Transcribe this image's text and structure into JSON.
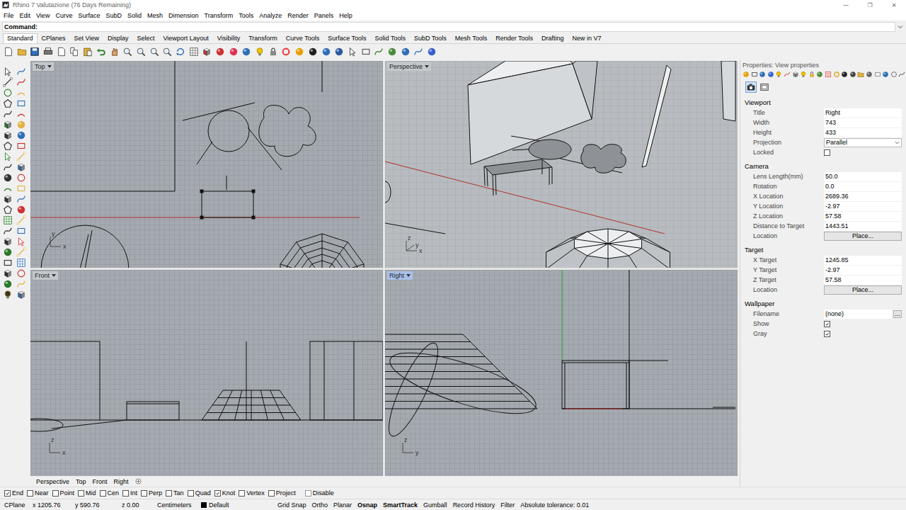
{
  "window": {
    "title": "Rhino 7 Valutazione (76 Days Remaining)",
    "controls": [
      "—",
      "❐",
      "✕"
    ]
  },
  "menu": [
    "File",
    "Edit",
    "View",
    "Curve",
    "Surface",
    "SubD",
    "Solid",
    "Mesh",
    "Dimension",
    "Transform",
    "Tools",
    "Analyze",
    "Render",
    "Panels",
    "Help"
  ],
  "command": {
    "label": "Command:"
  },
  "toolbar_tabs": [
    {
      "label": "Standard",
      "selected": true
    },
    {
      "label": "CPlanes",
      "selected": false
    },
    {
      "label": "Set View",
      "selected": false
    },
    {
      "label": "Display",
      "selected": false
    },
    {
      "label": "Select",
      "selected": false
    },
    {
      "label": "Viewport Layout",
      "selected": false
    },
    {
      "label": "Visibility",
      "selected": false
    },
    {
      "label": "Transform",
      "selected": false
    },
    {
      "label": "Curve Tools",
      "selected": false
    },
    {
      "label": "Surface Tools",
      "selected": false
    },
    {
      "label": "Solid Tools",
      "selected": false
    },
    {
      "label": "SubD Tools",
      "selected": false
    },
    {
      "label": "Mesh Tools",
      "selected": false
    },
    {
      "label": "Render Tools",
      "selected": false
    },
    {
      "label": "Drafting",
      "selected": false
    },
    {
      "label": "New in V7",
      "selected": false
    }
  ],
  "viewports": [
    {
      "title": "Top",
      "active": false,
      "axes": [
        "y",
        "x"
      ]
    },
    {
      "title": "Perspective",
      "active": false,
      "axes": [
        "z",
        "y",
        "x"
      ]
    },
    {
      "title": "Front",
      "active": false,
      "axes": [
        "z",
        "x"
      ]
    },
    {
      "title": "Right",
      "active": true,
      "axes": [
        "z",
        "y"
      ]
    }
  ],
  "viewport_tabs": [
    {
      "label": "Perspective",
      "selected": false
    },
    {
      "label": "Top",
      "selected": false
    },
    {
      "label": "Front",
      "selected": false
    },
    {
      "label": "Right",
      "selected": false
    }
  ],
  "properties": {
    "header": "Properties: View properties",
    "pages": [
      {
        "selected": true
      },
      {
        "selected": false
      }
    ],
    "sections": [
      {
        "title": "Viewport",
        "rows": [
          {
            "label": "Title",
            "kind": "text",
            "value": "Right"
          },
          {
            "label": "Width",
            "kind": "text",
            "value": "743"
          },
          {
            "label": "Height",
            "kind": "text",
            "value": "433"
          },
          {
            "label": "Projection",
            "kind": "select",
            "value": "Parallel"
          },
          {
            "label": "Locked",
            "kind": "check",
            "checked": false
          }
        ]
      },
      {
        "title": "Camera",
        "rows": [
          {
            "label": "Lens Length(mm)",
            "kind": "text",
            "value": "50.0"
          },
          {
            "label": "Rotation",
            "kind": "text",
            "value": "0.0"
          },
          {
            "label": "X Location",
            "kind": "text",
            "value": "2689.36"
          },
          {
            "label": "Y Location",
            "kind": "text",
            "value": "-2.97"
          },
          {
            "label": "Z Location",
            "kind": "text",
            "value": "57.58"
          },
          {
            "label": "Distance to Target",
            "kind": "text",
            "value": "1443.51"
          },
          {
            "label": "Location",
            "kind": "button",
            "value": "Place..."
          }
        ]
      },
      {
        "title": "Target",
        "rows": [
          {
            "label": "X Target",
            "kind": "text",
            "value": "1245.85"
          },
          {
            "label": "Y Target",
            "kind": "text",
            "value": "-2.97"
          },
          {
            "label": "Z Target",
            "kind": "text",
            "value": "57.58"
          },
          {
            "label": "Location",
            "kind": "button",
            "value": "Place..."
          }
        ]
      },
      {
        "title": "Wallpaper",
        "rows": [
          {
            "label": "Filename",
            "kind": "file",
            "value": "(none)",
            "button": "..."
          },
          {
            "label": "Show",
            "kind": "check",
            "checked": true
          },
          {
            "label": "Gray",
            "kind": "check",
            "checked": true
          }
        ]
      }
    ]
  },
  "osnap": {
    "items": [
      {
        "label": "End",
        "checked": true
      },
      {
        "label": "Near",
        "checked": false
      },
      {
        "label": "Point",
        "checked": false
      },
      {
        "label": "Mid",
        "checked": false
      },
      {
        "label": "Cen",
        "checked": false
      },
      {
        "label": "Int",
        "checked": false
      },
      {
        "label": "Perp",
        "checked": false
      },
      {
        "label": "Tan",
        "checked": false
      },
      {
        "label": "Quad",
        "checked": false
      },
      {
        "label": "Knot",
        "checked": true
      },
      {
        "label": "Vertex",
        "checked": false
      },
      {
        "label": "Project",
        "checked": false
      }
    ],
    "disable": {
      "label": "Disable",
      "checked": false
    }
  },
  "status_bar": {
    "cplane": "CPlane",
    "x": "x 1205.76",
    "y": "y 590.76",
    "z": "z 0.00",
    "units": "Centimeters",
    "layer": {
      "name": "Default",
      "color": "#000000"
    },
    "toggles": [
      {
        "label": "Grid Snap",
        "on": false
      },
      {
        "label": "Ortho",
        "on": false
      },
      {
        "label": "Planar",
        "on": false
      },
      {
        "label": "Osnap",
        "on": true
      },
      {
        "label": "SmartTrack",
        "on": true
      },
      {
        "label": "Gumball",
        "on": false
      },
      {
        "label": "Record History",
        "on": false
      },
      {
        "label": "Filter",
        "on": false
      }
    ],
    "tolerance": "Absolute tolerance: 0.01"
  }
}
